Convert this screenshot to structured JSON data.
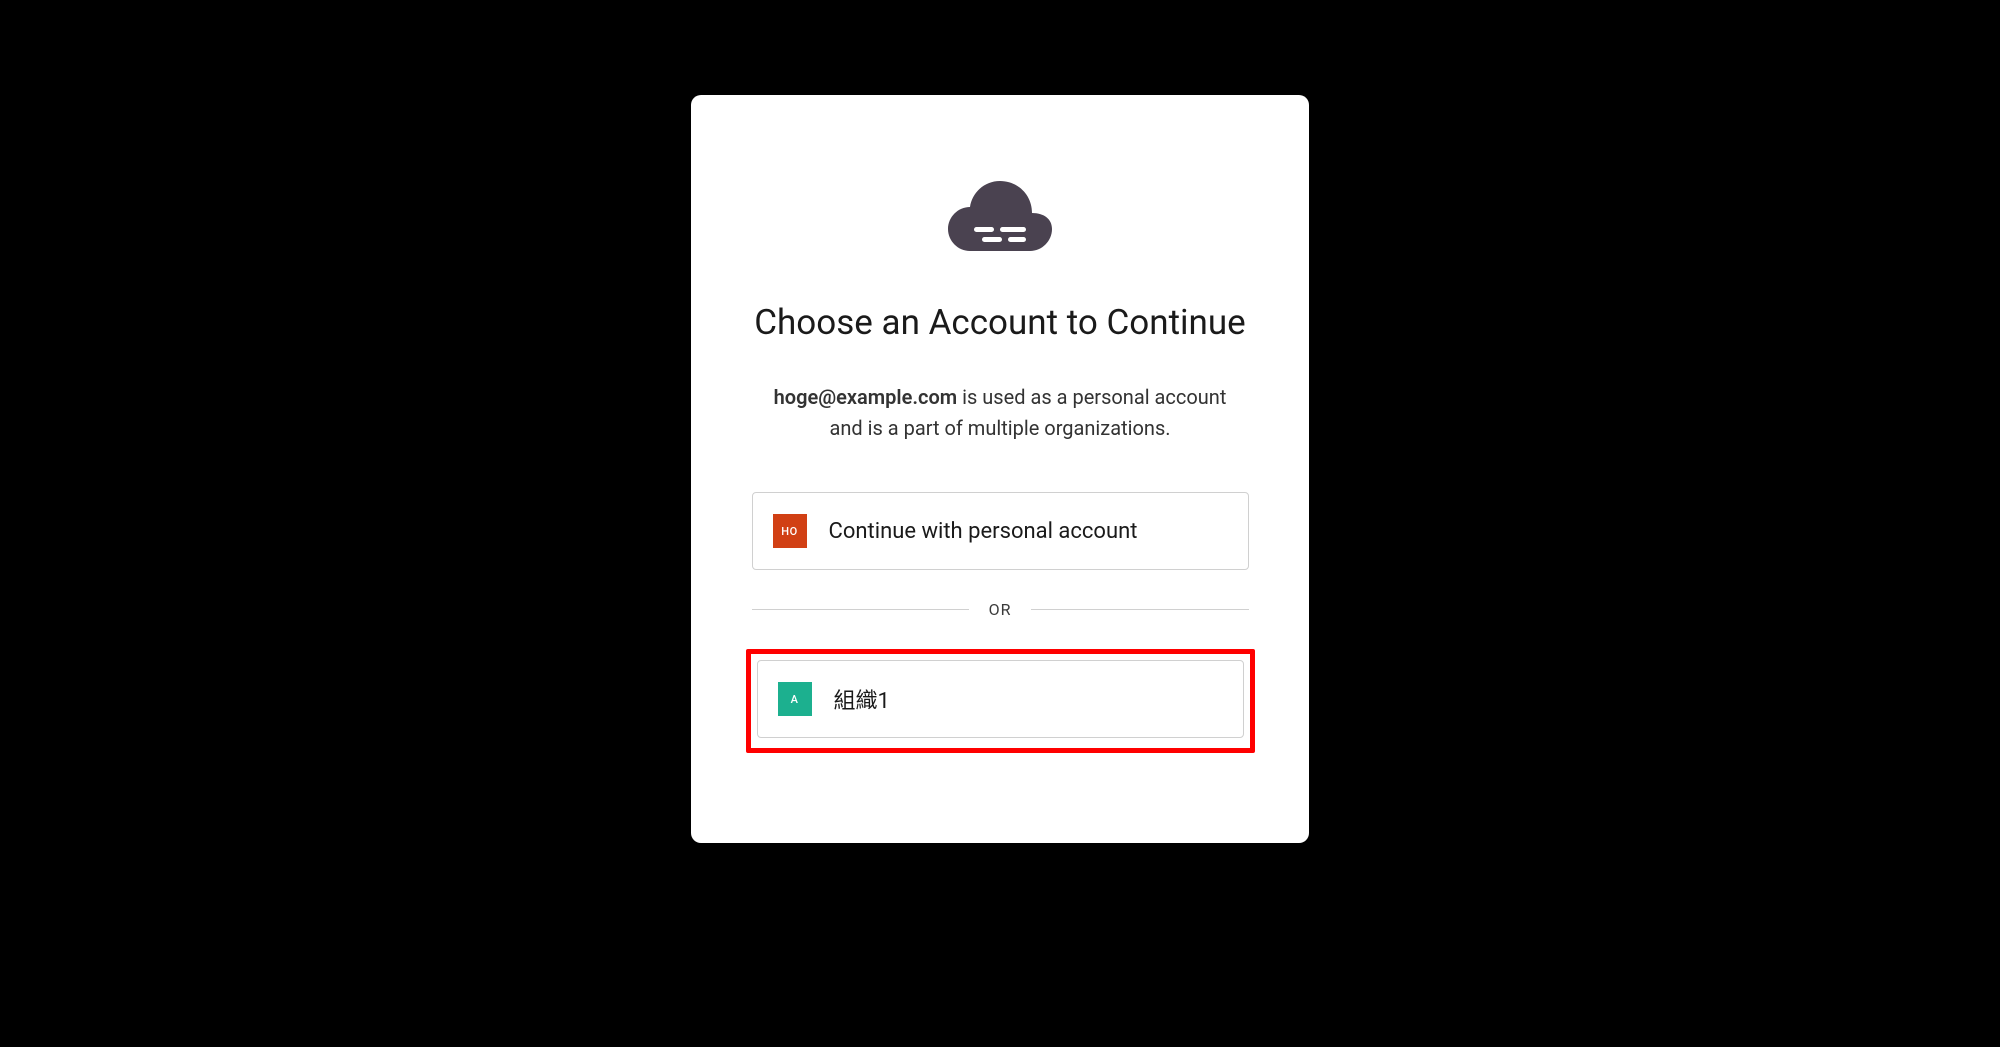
{
  "header": {
    "title": "Choose an Account to Continue",
    "subtitle_email": "hoge@example.com",
    "subtitle_rest": " is used as a personal account and is a part of multiple organizations."
  },
  "personal": {
    "avatar_initials": "HO",
    "label": "Continue with personal account",
    "avatar_color": "#d14014"
  },
  "divider": {
    "text": "OR"
  },
  "organizations": [
    {
      "avatar_initial": "A",
      "label": "組織1",
      "avatar_color": "#1cb08f",
      "highlighted": true
    }
  ]
}
